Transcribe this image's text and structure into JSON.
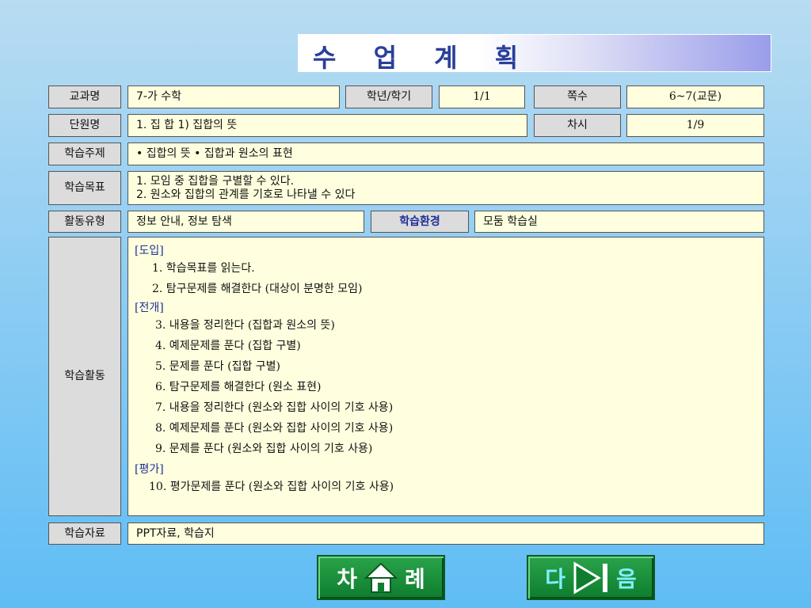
{
  "title": "수 업 계 획",
  "rows": {
    "subject": {
      "label": "교과명",
      "value": "7-가  수학",
      "grade_label": "학년/학기",
      "grade_value": "1/1",
      "page_label": "쪽수",
      "page_value": "6~7(교문)"
    },
    "unit": {
      "label": "단원명",
      "value": "1. 집   합      1) 집합의 뜻",
      "session_label": "차시",
      "session_value": "1/9"
    },
    "topic": {
      "label": "학습주제",
      "value": "• 집합의 뜻          • 집합과 원소의 표현"
    },
    "goals": {
      "label": "학습목표",
      "line1": "1. 모임 중 집합을 구별할 수 있다.",
      "line2": "2. 원소와 집합의 관계를 기호로 나타낼 수 있다"
    },
    "activity": {
      "label": "활동유형",
      "value": "정보 안내, 정보 탐색",
      "env_label": "학습환경",
      "env_value": "모둠 학습실"
    },
    "learning": {
      "label": "학습활동",
      "intro_title": "[도입]",
      "intro_items": [
        "1. 학습목표를 읽는다.",
        "2. 탐구문제를 해결한다 (대상이 분명한 모임)"
      ],
      "dev_title": "[전개]",
      "dev_items": [
        "3. 내용을 정리한다 (집합과 원소의 뜻)",
        "4. 예제문제를 푼다 (집합 구별)",
        "5. 문제를 푼다 (집합 구별)",
        "6. 탐구문제를 해결한다 (원소 표현)",
        "7. 내용을 정리한다 (원소와 집합 사이의 기호 사용)",
        "8. 예제문제를 푼다 (원소와 집합 사이의 기호 사용)",
        "9. 문제를 푼다 (원소와 집합 사이의 기호 사용)"
      ],
      "eval_title": "[평가]",
      "eval_items": [
        "10. 평가문제를 푼다 (원소와 집합 사이의 기호 사용)"
      ]
    },
    "materials": {
      "label": "학습자료",
      "value": "PPT자료,  학습지"
    }
  },
  "nav": {
    "toc_left": "차",
    "toc_right": "례",
    "toc_icon": "home-icon",
    "next_left": "다",
    "next_right": "음",
    "next_icon": "next-arrow-icon"
  },
  "colors": {
    "cell_bg": "#ffffdf",
    "label_bg": "#dcdcdc",
    "section_title": "#1d2f95",
    "button_green": "#0e7d2e",
    "title_text": "#2a3f9a"
  }
}
